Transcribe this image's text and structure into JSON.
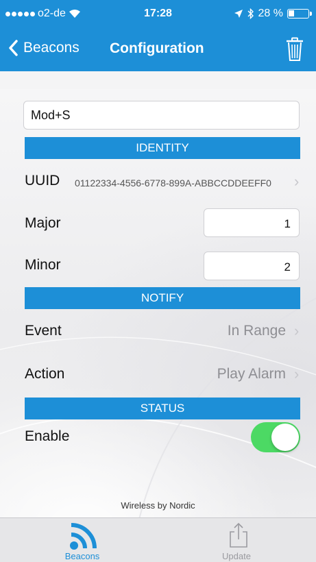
{
  "status_bar": {
    "carrier": "o2-de",
    "time": "17:28",
    "battery": "28 %",
    "battery_level": 0.28
  },
  "nav": {
    "back_label": "Beacons",
    "title": "Configuration",
    "delete_icon": "trash-icon"
  },
  "beacon_name": "Mod+S",
  "sections": {
    "identity": "IDENTITY",
    "notify": "NOTIFY",
    "status": "STATUS"
  },
  "identity": {
    "uuid_label": "UUID",
    "uuid_value": "01122334-4556-6778-899A-ABBCCDDEEFF0",
    "major_label": "Major",
    "major_value": "1",
    "minor_label": "Minor",
    "minor_value": "2"
  },
  "notify": {
    "event_label": "Event",
    "event_value": "In Range",
    "action_label": "Action",
    "action_value": "Play Alarm"
  },
  "status": {
    "enable_label": "Enable",
    "enabled": true,
    "toggle_color": "#4cd964"
  },
  "footer": "Wireless by Nordic",
  "tabs": [
    {
      "label": "Beacons",
      "icon": "beacon-signal-icon",
      "active": true
    },
    {
      "label": "Update",
      "icon": "share-upload-icon",
      "active": false
    }
  ],
  "colors": {
    "brand": "#1d8fd7",
    "chevron": "#c7c7cc"
  }
}
